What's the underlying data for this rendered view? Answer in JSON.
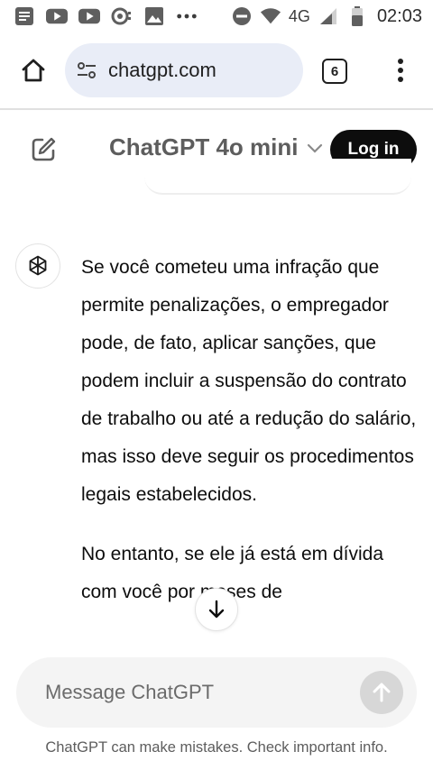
{
  "status_bar": {
    "network_label": "4G",
    "time": "02:03",
    "icons": [
      "news-icon",
      "youtube-icon",
      "youtube-icon",
      "podcast-icon",
      "gallery-icon",
      "more-notifications-icon",
      "do-not-disturb-icon",
      "wifi-icon",
      "signal-icon",
      "battery-icon"
    ]
  },
  "browser": {
    "url": "chatgpt.com",
    "tab_count": "6",
    "icons": [
      "home-icon",
      "site-settings-icon",
      "tabs-icon",
      "more-vert-icon"
    ]
  },
  "header": {
    "model_name": "ChatGPT 4o mini",
    "login_label": "Log in",
    "icons": [
      "new-chat-icon",
      "chevron-down-icon"
    ]
  },
  "conversation": {
    "assistant_paragraphs": [
      "Se você cometeu uma infração que permite penalizações, o empregador pode, de fato, aplicar sanções, que podem incluir a suspensão do contrato de trabalho ou até a redução do salário, mas isso deve seguir os procedimentos legais estabelecidos.",
      "No entanto, se ele já está em dívida com você por meses de"
    ],
    "icons": [
      "openai-logo-icon",
      "arrow-down-icon"
    ]
  },
  "composer": {
    "placeholder": "Message ChatGPT",
    "value": "",
    "disclaimer": "ChatGPT can make mistakes. Check important info.",
    "icons": [
      "arrow-up-icon"
    ]
  },
  "colors": {
    "login_bg": "#0d0d0d",
    "urlbar_bg": "#e9edf7",
    "composer_bg": "#f4f4f4",
    "send_disabled": "#d7d7d7"
  }
}
